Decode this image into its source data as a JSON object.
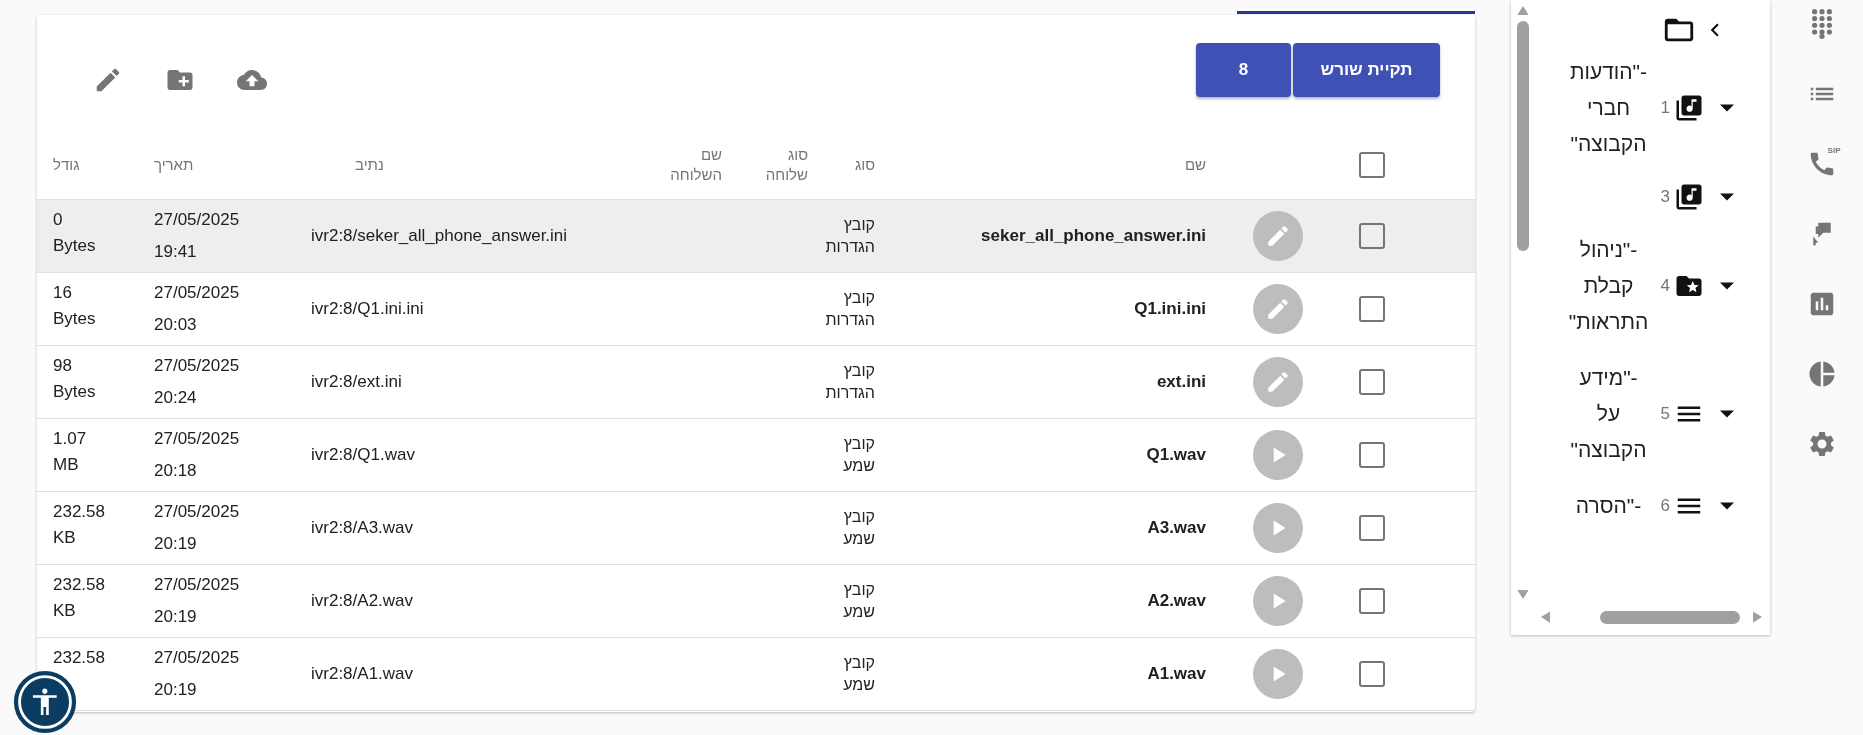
{
  "toolbar": {
    "root_button": "תקיית שורש",
    "count_button": "8",
    "actions": [
      {
        "kind": "upload"
      },
      {
        "kind": "new-folder"
      },
      {
        "kind": "edit"
      }
    ]
  },
  "table": {
    "header_checkbox": {
      "checked": false
    },
    "columns": [
      "שם",
      "סוג",
      "סוג שלוחה",
      "שם השלוחה",
      "נתיב",
      "תאריך",
      "גודל"
    ],
    "rows": [
      {
        "selected": true,
        "checked": false,
        "kind": "edit",
        "name": "seker_all_phone_answer.ini",
        "type": "קובץ הגדרות",
        "path": "ivr2:8/seker_all_phone_answer.ini",
        "date": "27/05/2025 19:41",
        "size": "0 Bytes"
      },
      {
        "selected": false,
        "checked": false,
        "kind": "edit",
        "name": "Q1.ini.ini",
        "type": "קובץ הגדרות",
        "path": "ivr2:8/Q1.ini.ini",
        "date": "27/05/2025 20:03",
        "size": "16 Bytes"
      },
      {
        "selected": false,
        "checked": false,
        "kind": "edit",
        "name": "ext.ini",
        "type": "קובץ הגדרות",
        "path": "ivr2:8/ext.ini",
        "date": "27/05/2025 20:24",
        "size": "98 Bytes"
      },
      {
        "selected": false,
        "checked": false,
        "kind": "play",
        "name": "Q1.wav",
        "type": "קובץ שמע",
        "path": "ivr2:8/Q1.wav",
        "date": "27/05/2025 20:18",
        "size": "1.07 MB"
      },
      {
        "selected": false,
        "checked": false,
        "kind": "play",
        "name": "A3.wav",
        "type": "קובץ שמע",
        "path": "ivr2:8/A3.wav",
        "date": "27/05/2025 20:19",
        "size": "232.58 KB"
      },
      {
        "selected": false,
        "checked": false,
        "kind": "play",
        "name": "A2.wav",
        "type": "קובץ שמע",
        "path": "ivr2:8/A2.wav",
        "date": "27/05/2025 20:19",
        "size": "232.58 KB"
      },
      {
        "selected": false,
        "checked": false,
        "kind": "play",
        "name": "A1.wav",
        "type": "קובץ שמע",
        "path": "ivr2:8/A1.wav",
        "date": "27/05/2025 20:19",
        "size": "232.58"
      }
    ]
  },
  "tree": {
    "items": [
      {
        "kind": "music",
        "number": "1",
        "label": "-\"הודעות חברי הקבוצה\""
      },
      {
        "kind": "music",
        "number": "3"
      },
      {
        "kind": "folder-star",
        "number": "4",
        "label": "-\"ניהול קבלת התראות\""
      },
      {
        "kind": "list",
        "number": "5",
        "label": "-\"מידע על הקבוצה\""
      },
      {
        "kind": "list",
        "number": "6",
        "label": "-\"הסרה"
      }
    ]
  },
  "nav": [
    {
      "kind": "dialpad"
    },
    {
      "kind": "list"
    },
    {
      "kind": "phone",
      "badge": "SIP"
    },
    {
      "kind": "forward"
    },
    {
      "kind": "bar-chart"
    },
    {
      "kind": "pie-chart"
    },
    {
      "kind": "settings"
    }
  ]
}
